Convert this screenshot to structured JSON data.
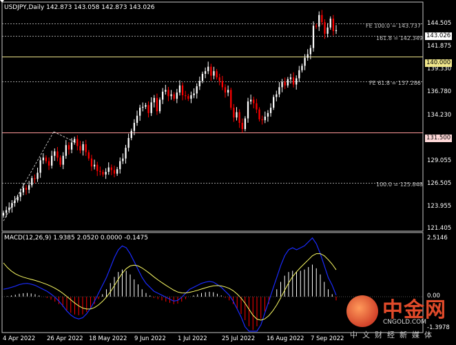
{
  "header": {
    "symbol_line": "USDJPY,Daily  142.873 143.058 142.873 143.026"
  },
  "macd": {
    "title": "MACD(12,26,9) 1.9385 2.0520 0.0000 -0.1475",
    "axis_top": "2.5146",
    "axis_zero": "0.00",
    "axis_bottom": "-1.3978"
  },
  "price_axis": {
    "ticks": [
      "144.505",
      "141.875",
      "139.330",
      "136.780",
      "134.230",
      "131.500",
      "129.055",
      "126.505",
      "123.955",
      "121.405"
    ]
  },
  "time_axis": {
    "labels": [
      "4 Apr 2022",
      "26 Apr 2022",
      "18 May 2022",
      "9 Jun 2022",
      "1 Jul 2022",
      "25 Jul 2022",
      "16 Aug 2022",
      "7 Sep 2022"
    ]
  },
  "levels": {
    "fe100_label": "FE 100.0 = 143.737",
    "fe161_label": "161.8 = 142.349",
    "fe61_label": "FE 61.8 = 137.286",
    "r100_label": "100.0 = 125.848",
    "current_price": "143.026",
    "level_140": "140.000",
    "level_131": "131.500"
  },
  "colors": {
    "bull": "#ffffff",
    "bear": "#ff0000",
    "macd_fast": "#1a2bff",
    "macd_signal": "#ffff66",
    "hline": "#f0e68c",
    "hline_131": "#ff9999"
  },
  "logo": {
    "cn": "中金网",
    "en": "CNGOLD.COM",
    "slogan": "中文财经新媒体"
  },
  "chart_data": {
    "type": "candlestick",
    "title": "USDJPY,Daily",
    "ohlc_last": {
      "open": 142.873,
      "high": 143.058,
      "low": 142.873,
      "close": 143.026
    },
    "ylim": [
      120.6,
      146.0
    ],
    "x_tick_labels": [
      "4 Apr 2022",
      "26 Apr 2022",
      "18 May 2022",
      "9 Jun 2022",
      "1 Jul 2022",
      "25 Jul 2022",
      "16 Aug 2022",
      "7 Sep 2022"
    ],
    "closes": [
      122.5,
      122.8,
      123.1,
      123.6,
      123.9,
      124.3,
      124.8,
      125.3,
      125.1,
      125.6,
      126.4,
      126.3,
      127.0,
      128.4,
      128.7,
      128.3,
      127.8,
      128.9,
      129.4,
      128.7,
      127.9,
      128.9,
      130.1,
      129.6,
      130.4,
      130.8,
      130.0,
      129.5,
      130.2,
      129.3,
      128.6,
      127.7,
      127.9,
      127.2,
      127.1,
      126.8,
      127.1,
      127.6,
      127.3,
      126.9,
      127.4,
      128.3,
      128.6,
      129.8,
      130.9,
      131.7,
      132.6,
      133.4,
      134.3,
      134.4,
      134.6,
      133.7,
      134.9,
      135.4,
      133.9,
      135.2,
      136.1,
      136.3,
      135.6,
      135.8,
      135.3,
      136.0,
      136.8,
      135.7,
      135.6,
      135.3,
      135.7,
      135.9,
      136.7,
      137.3,
      138.1,
      138.4,
      138.9,
      137.9,
      138.4,
      137.7,
      137.3,
      136.6,
      136.0,
      136.3,
      134.3,
      133.2,
      133.8,
      132.6,
      131.9,
      133.1,
      135.0,
      135.2,
      134.8,
      134.1,
      133.0,
      132.9,
      133.3,
      133.7,
      134.3,
      135.5,
      135.8,
      136.6,
      137.2,
      136.8,
      137.5,
      137.7,
      136.9,
      137.6,
      138.5,
      139.0,
      139.9,
      140.3,
      141.0,
      143.5,
      143.4,
      144.7,
      143.9,
      142.6,
      143.3,
      144.3,
      142.9,
      143.0
    ],
    "levels": [
      {
        "label": "FE 100.0",
        "value": 143.737
      },
      {
        "label": "161.8",
        "value": 142.349
      },
      {
        "label": "horizontal",
        "value": 140.0
      },
      {
        "label": "FE 61.8",
        "value": 137.286
      },
      {
        "label": "horizontal",
        "value": 131.5
      },
      {
        "label": "100.0",
        "value": 125.848
      }
    ],
    "macd": {
      "params": "12,26,9",
      "main": 1.9385,
      "signal": 2.052,
      "hist_last": -0.1475,
      "ylim": [
        -1.3978,
        2.5146
      ],
      "histogram": [
        0.0,
        0.02,
        0.05,
        0.08,
        0.12,
        0.14,
        0.15,
        0.13,
        0.1,
        0.05,
        0.0,
        -0.05,
        -0.12,
        -0.2,
        -0.3,
        -0.42,
        -0.55,
        -0.65,
        -0.72,
        -0.75,
        -0.72,
        -0.62,
        -0.48,
        -0.3,
        -0.1,
        0.1,
        0.3,
        0.55,
        0.8,
        1.0,
        1.1,
        1.05,
        0.9,
        0.7,
        0.5,
        0.3,
        0.15,
        0.05,
        -0.05,
        -0.1,
        -0.15,
        -0.2,
        -0.25,
        -0.3,
        -0.28,
        -0.2,
        -0.1,
        0.0,
        0.05,
        0.1,
        0.15,
        0.18,
        0.2,
        0.18,
        0.12,
        0.05,
        -0.05,
        -0.15,
        -0.3,
        -0.5,
        -0.7,
        -0.95,
        -1.2,
        -1.35,
        -1.2,
        -0.9,
        -0.6,
        -0.3,
        0.0,
        0.3,
        0.6,
        0.85,
        1.0,
        1.05,
        1.0,
        1.05,
        1.1,
        1.2,
        1.3,
        1.15,
        0.9,
        0.6,
        0.3,
        0.1,
        -0.15
      ]
    }
  }
}
